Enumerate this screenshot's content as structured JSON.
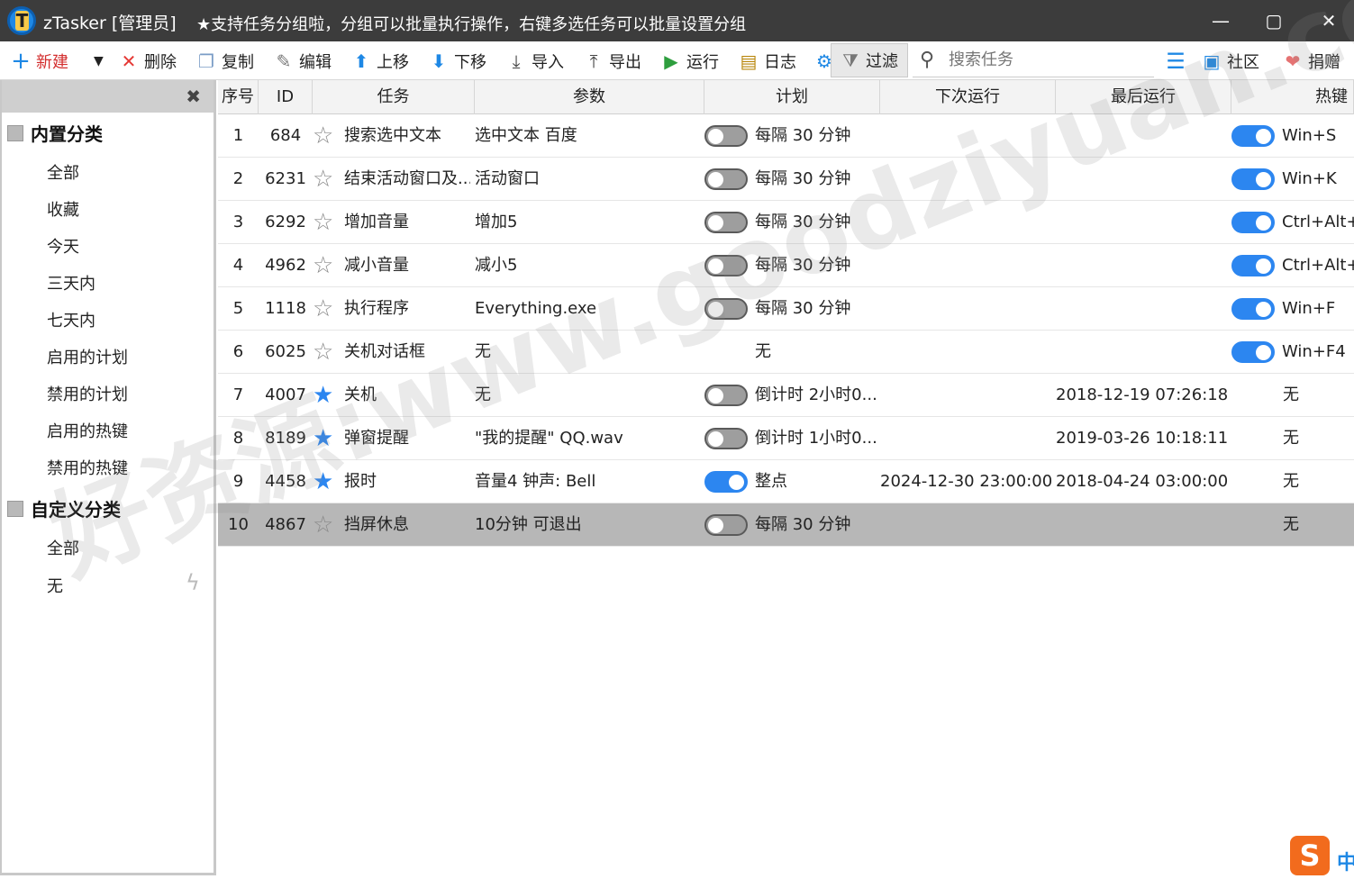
{
  "window": {
    "app_name": "zTasker [管理员]",
    "notice": "★支持任务分组啦，分组可以批量执行操作，右键多选任务可以批量设置分组",
    "logo_letter": "T"
  },
  "toolbar": {
    "new_label": "新建",
    "delete_label": "删除",
    "copy_label": "复制",
    "edit_label": "编辑",
    "up_label": "上移",
    "down_label": "下移",
    "import_label": "导入",
    "export_label": "导出",
    "run_label": "运行",
    "log_label": "日志",
    "filter_label": "过滤",
    "search_placeholder": "搜索任务",
    "community_label": "社区",
    "donate_label": "捐赠"
  },
  "sidebar": {
    "builtin_title": "内置分类",
    "builtin_items": [
      "全部",
      "收藏",
      "今天",
      "三天内",
      "七天内",
      "启用的计划",
      "禁用的计划",
      "启用的热键",
      "禁用的热键"
    ],
    "custom_title": "自定义分类",
    "custom_items": [
      "全部",
      "无"
    ]
  },
  "table": {
    "headers": [
      "序号",
      "ID",
      "任务",
      "参数",
      "计划",
      "下次运行",
      "最后运行",
      "热键"
    ],
    "rows": [
      {
        "seq": "1",
        "id": "684",
        "task": "搜索选中文本",
        "param": "选中文本 百度",
        "plan_on": false,
        "plan_toggle": true,
        "plan": "每隔 30 分钟",
        "next": "",
        "last": "",
        "hk_toggle": true,
        "hotkey": "Win+S",
        "fav": false
      },
      {
        "seq": "2",
        "id": "6231",
        "task": "结束活动窗口及...",
        "param": "活动窗口",
        "plan_on": false,
        "plan_toggle": true,
        "plan": "每隔 30 分钟",
        "next": "",
        "last": "",
        "hk_toggle": true,
        "hotkey": "Win+K",
        "fav": false
      },
      {
        "seq": "3",
        "id": "6292",
        "task": "增加音量",
        "param": "增加5",
        "plan_on": false,
        "plan_toggle": true,
        "plan": "每隔 30 分钟",
        "next": "",
        "last": "",
        "hk_toggle": true,
        "hotkey": "Ctrl+Alt+",
        "fav": false
      },
      {
        "seq": "4",
        "id": "4962",
        "task": "减小音量",
        "param": "减小5",
        "plan_on": false,
        "plan_toggle": true,
        "plan": "每隔 30 分钟",
        "next": "",
        "last": "",
        "hk_toggle": true,
        "hotkey": "Ctrl+Alt+",
        "fav": false
      },
      {
        "seq": "5",
        "id": "1118",
        "task": "执行程序",
        "param": "Everything.exe",
        "plan_on": false,
        "plan_toggle": true,
        "plan": "每隔 30 分钟",
        "next": "",
        "last": "",
        "hk_toggle": true,
        "hotkey": "Win+F",
        "fav": false
      },
      {
        "seq": "6",
        "id": "6025",
        "task": "关机对话框",
        "param": "无",
        "plan_on": false,
        "plan_toggle": false,
        "plan": "无",
        "next": "",
        "last": "",
        "hk_toggle": true,
        "hotkey": "Win+F4",
        "fav": false
      },
      {
        "seq": "7",
        "id": "4007",
        "task": "关机",
        "param": "无",
        "plan_on": false,
        "plan_toggle": true,
        "plan": "倒计时 2小时0...",
        "next": "",
        "last": "2018-12-19 07:26:18",
        "hk_toggle": false,
        "hotkey": "无",
        "fav": true
      },
      {
        "seq": "8",
        "id": "8189",
        "task": "弹窗提醒",
        "param": "\"我的提醒\" QQ.wav",
        "plan_on": false,
        "plan_toggle": true,
        "plan": "倒计时 1小时0...",
        "next": "",
        "last": "2019-03-26 10:18:11",
        "hk_toggle": false,
        "hotkey": "无",
        "fav": true
      },
      {
        "seq": "9",
        "id": "4458",
        "task": "报时",
        "param": "音量4 钟声: Bell",
        "plan_on": true,
        "plan_toggle": true,
        "plan": "整点",
        "next": "2024-12-30 23:00:00",
        "last": "2018-04-24 03:00:00",
        "hk_toggle": false,
        "hotkey": "无",
        "fav": true
      },
      {
        "seq": "10",
        "id": "4867",
        "task": "挡屏休息",
        "param": "10分钟 可退出",
        "plan_on": false,
        "plan_toggle": true,
        "plan": "每隔 30 分钟",
        "next": "",
        "last": "",
        "hk_toggle": false,
        "hotkey": "无",
        "fav": false,
        "selected": true
      }
    ]
  },
  "watermark": "好资源:www.goodziyuan.com",
  "ime": {
    "logo": "S",
    "mode": "中"
  },
  "colors": {
    "accent": "#2c86f0",
    "titlebar": "#3c3c3c",
    "selected_row": "#b7b7b7",
    "new_icon": "#1e88e5",
    "delete_icon": "#e53935",
    "run_icon": "#2e9e3e"
  }
}
